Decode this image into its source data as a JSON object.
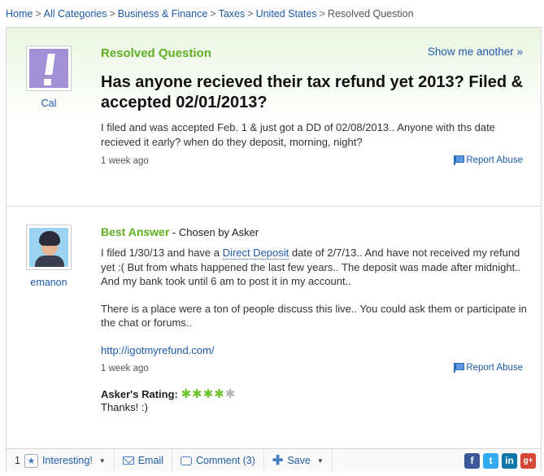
{
  "breadcrumb": {
    "items": [
      "Home",
      "All Categories",
      "Business & Finance",
      "Taxes",
      "United States"
    ],
    "separator": ">",
    "current": "Resolved Question"
  },
  "question": {
    "status_label": "Resolved Question",
    "show_another": "Show me another »",
    "asker_name": "Cal",
    "title": "Has anyone recieved their tax refund yet 2013? Filed & accepted 02/01/2013?",
    "body": "I filed and was accepted Feb. 1 & just got a DD of 02/08/2013.. Anyone with ths date recieved it early? when do they deposit, morning, night?",
    "time": "1 week ago",
    "report": "Report Abuse"
  },
  "answer": {
    "label": "Best Answer",
    "chosen_by": "- Chosen by Asker",
    "answerer_name": "emanon",
    "body_part1": "I filed 1/30/13 and have a ",
    "body_link": "Direct Deposit",
    "body_part2": " date of 2/7/13.. And have not received my refund yet :( But from whats happened the last few years.. The deposit was made after midnight.. And my bank took until 6 am to post it in my account..",
    "body_para2": "There is a place were a ton of people discuss this live.. You could ask them or participate in the chat or forums..",
    "url": "http://igotmyrefund.com/",
    "time": "1 week ago",
    "report": "Report Abuse",
    "rating_label": "Asker's Rating:",
    "rating": 4,
    "rating_max": 5,
    "comment": "Thanks! :)"
  },
  "toolbar": {
    "interesting_count": "1",
    "interesting_label": "Interesting!",
    "email_label": "Email",
    "comment_label": "Comment (3)",
    "save_label": "Save",
    "social": [
      {
        "name": "facebook-icon",
        "glyph": "f"
      },
      {
        "name": "twitter-icon",
        "glyph": "t"
      },
      {
        "name": "linkedin-icon",
        "glyph": "in"
      },
      {
        "name": "google-plus-icon",
        "glyph": "g+"
      }
    ]
  },
  "colors": {
    "accent_green": "#5fae22",
    "link_blue": "#1e5aa8",
    "star_on": "#6bc42c",
    "star_off": "#b5b5b5"
  }
}
